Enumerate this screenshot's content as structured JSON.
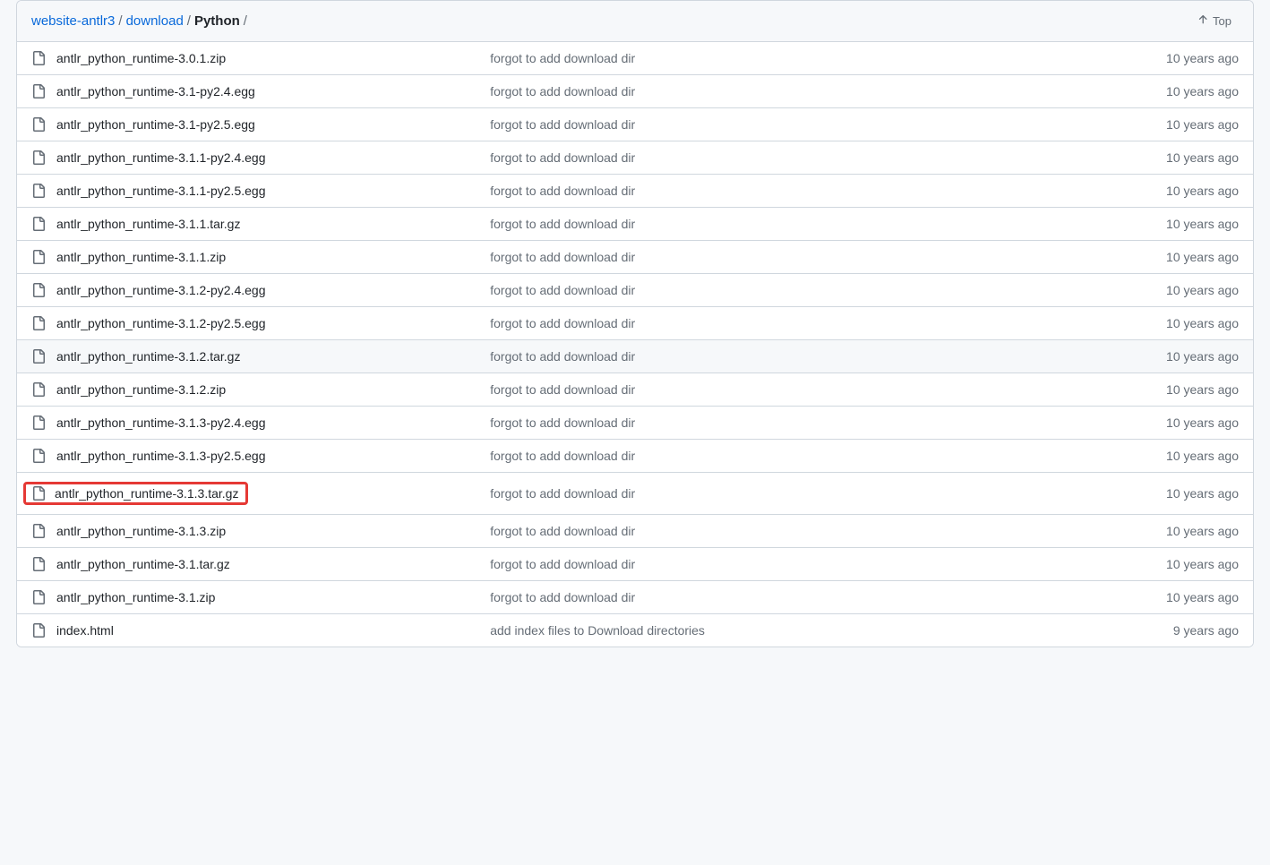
{
  "breadcrumb": {
    "root": "website-antlr3",
    "folder": "download",
    "current": "Python",
    "separator": "/"
  },
  "top_button": {
    "label": "Top"
  },
  "files": [
    {
      "name": "antlr_python_runtime-3.0.1.zip",
      "commit": "forgot to add download dir",
      "time": "10 years ago",
      "highlighted": false,
      "selected": false
    },
    {
      "name": "antlr_python_runtime-3.1-py2.4.egg",
      "commit": "forgot to add download dir",
      "time": "10 years ago",
      "highlighted": false,
      "selected": false
    },
    {
      "name": "antlr_python_runtime-3.1-py2.5.egg",
      "commit": "forgot to add download dir",
      "time": "10 years ago",
      "highlighted": false,
      "selected": false
    },
    {
      "name": "antlr_python_runtime-3.1.1-py2.4.egg",
      "commit": "forgot to add download dir",
      "time": "10 years ago",
      "highlighted": false,
      "selected": false
    },
    {
      "name": "antlr_python_runtime-3.1.1-py2.5.egg",
      "commit": "forgot to add download dir",
      "time": "10 years ago",
      "highlighted": false,
      "selected": false
    },
    {
      "name": "antlr_python_runtime-3.1.1.tar.gz",
      "commit": "forgot to add download dir",
      "time": "10 years ago",
      "highlighted": false,
      "selected": false
    },
    {
      "name": "antlr_python_runtime-3.1.1.zip",
      "commit": "forgot to add download dir",
      "time": "10 years ago",
      "highlighted": false,
      "selected": false
    },
    {
      "name": "antlr_python_runtime-3.1.2-py2.4.egg",
      "commit": "forgot to add download dir",
      "time": "10 years ago",
      "highlighted": false,
      "selected": false
    },
    {
      "name": "antlr_python_runtime-3.1.2-py2.5.egg",
      "commit": "forgot to add download dir",
      "time": "10 years ago",
      "highlighted": false,
      "selected": false
    },
    {
      "name": "antlr_python_runtime-3.1.2.tar.gz",
      "commit": "forgot to add download dir",
      "time": "10 years ago",
      "highlighted": false,
      "selected": true
    },
    {
      "name": "antlr_python_runtime-3.1.2.zip",
      "commit": "forgot to add download dir",
      "time": "10 years ago",
      "highlighted": false,
      "selected": false
    },
    {
      "name": "antlr_python_runtime-3.1.3-py2.4.egg",
      "commit": "forgot to add download dir",
      "time": "10 years ago",
      "highlighted": false,
      "selected": false
    },
    {
      "name": "antlr_python_runtime-3.1.3-py2.5.egg",
      "commit": "forgot to add download dir",
      "time": "10 years ago",
      "highlighted": false,
      "selected": false
    },
    {
      "name": "antlr_python_runtime-3.1.3.tar.gz",
      "commit": "forgot to add download dir",
      "time": "10 years ago",
      "highlighted": true,
      "selected": false
    },
    {
      "name": "antlr_python_runtime-3.1.3.zip",
      "commit": "forgot to add download dir",
      "time": "10 years ago",
      "highlighted": false,
      "selected": false
    },
    {
      "name": "antlr_python_runtime-3.1.tar.gz",
      "commit": "forgot to add download dir",
      "time": "10 years ago",
      "highlighted": false,
      "selected": false
    },
    {
      "name": "antlr_python_runtime-3.1.zip",
      "commit": "forgot to add download dir",
      "time": "10 years ago",
      "highlighted": false,
      "selected": false
    },
    {
      "name": "index.html",
      "commit": "add index files to Download directories",
      "time": "9 years ago",
      "highlighted": false,
      "selected": false
    }
  ]
}
